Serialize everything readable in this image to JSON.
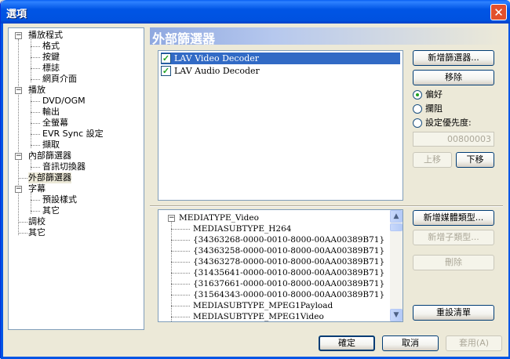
{
  "window": {
    "title": "選項"
  },
  "tree": {
    "items": [
      {
        "label": "播放程式"
      },
      {
        "label": "格式"
      },
      {
        "label": "按鍵"
      },
      {
        "label": "標誌"
      },
      {
        "label": "網頁介面"
      },
      {
        "label": "播放"
      },
      {
        "label": "DVD/OGM"
      },
      {
        "label": "輸出"
      },
      {
        "label": "全螢幕"
      },
      {
        "label": "EVR Sync 設定"
      },
      {
        "label": "擷取"
      },
      {
        "label": "內部篩選器"
      },
      {
        "label": "音訊切換器"
      },
      {
        "label": "外部篩選器"
      },
      {
        "label": "字幕"
      },
      {
        "label": "預設樣式"
      },
      {
        "label": "其它"
      },
      {
        "label": "調校"
      },
      {
        "label": "其它"
      }
    ]
  },
  "panel": {
    "title": "外部篩選器"
  },
  "filters": [
    {
      "label": "LAV Video Decoder",
      "checked": true,
      "selected": true
    },
    {
      "label": "LAV Audio Decoder",
      "checked": true,
      "selected": false
    }
  ],
  "buttons": {
    "add_filter": "新增篩選器...",
    "remove": "移除",
    "move_up": "上移",
    "move_down": "下移",
    "add_media_type": "新增媒體類型...",
    "add_subtype": "新增子類型...",
    "delete": "刪除",
    "reset_list": "重設清單",
    "ok": "確定",
    "cancel": "取消",
    "apply": "套用(A)"
  },
  "merit": {
    "options": [
      {
        "label": "偏好",
        "selected": true
      },
      {
        "label": "攔阻",
        "selected": false
      },
      {
        "label": "設定優先度:",
        "selected": false
      }
    ],
    "priority_value": "00800003"
  },
  "media_types": {
    "root": "MEDIATYPE_Video",
    "items": [
      "MEDIASUBTYPE_H264",
      "{34363268-0000-0010-8000-00AA00389B71}",
      "{34363258-0000-0010-8000-00AA00389B71}",
      "{34363278-0000-0010-8000-00AA00389B71}",
      "{31435641-0000-0010-8000-00AA00389B71}",
      "{31637661-0000-0010-8000-00AA00389B71}",
      "{31564343-0000-0010-8000-00AA00389B71}",
      "MEDIASUBTYPE_MPEG1Payload",
      "MEDIASUBTYPE_MPEG1Video"
    ]
  },
  "icons": {
    "close": "close-icon",
    "checkbox": "checkmark-icon",
    "scroll_up": "arrow-up-icon",
    "scroll_down": "arrow-down-icon"
  }
}
